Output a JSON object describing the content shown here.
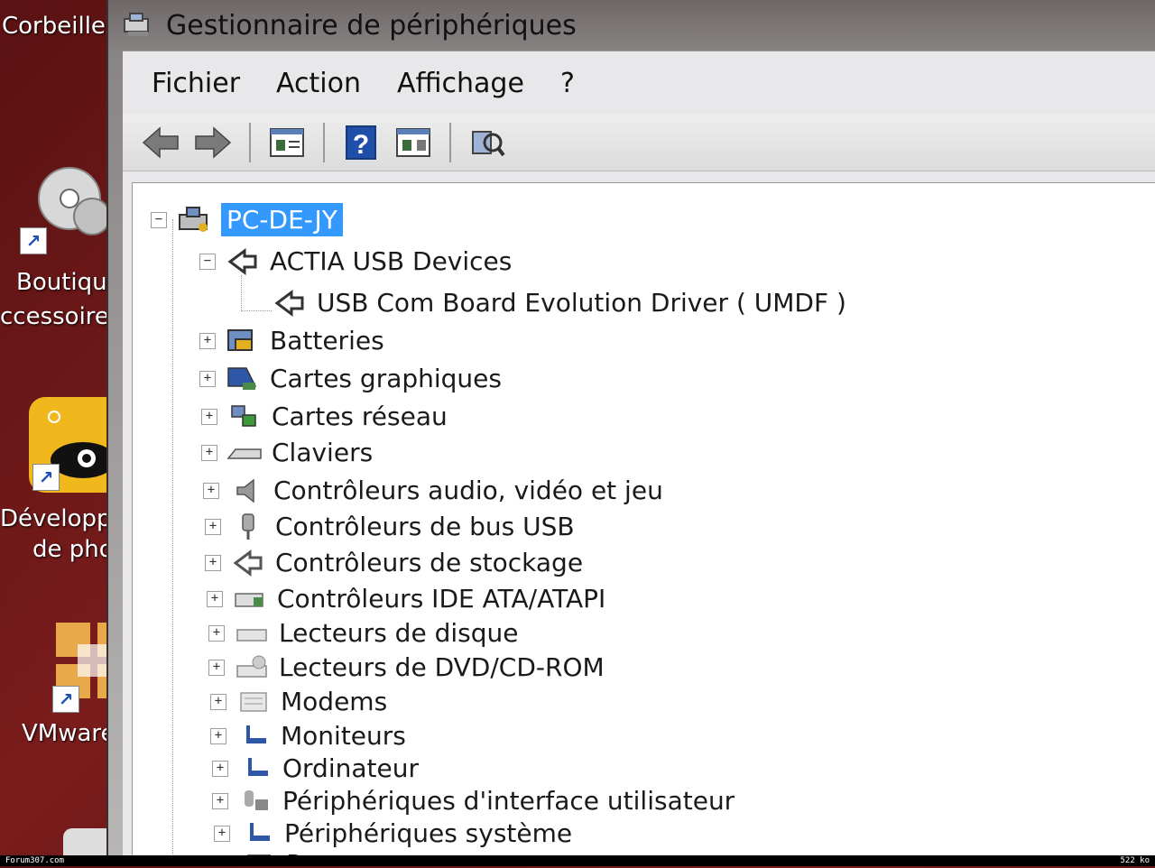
{
  "desktop": {
    "items": [
      {
        "label": "Corbeille",
        "icon": "recycle-bin-icon"
      },
      {
        "label": "Boutique",
        "label2": "ccessoires",
        "icon": "disc-icon"
      },
      {
        "label": "Développem",
        "label2": "de photo",
        "icon": "photo-app-icon"
      },
      {
        "label": "VMware Pla",
        "icon": "vmware-icon"
      }
    ]
  },
  "window": {
    "title": "Gestionnaire de périphériques",
    "icon": "device-manager-icon"
  },
  "menu": [
    "Fichier",
    "Action",
    "Affichage",
    "?"
  ],
  "toolbar": {
    "buttons": [
      "back-arrow-icon",
      "forward-arrow-icon",
      "properties-view-icon",
      "help-icon",
      "show-hide-icon",
      "scan-hardware-icon"
    ]
  },
  "tree": {
    "root": "PC-DE-JY",
    "actia": "ACTIA USB Devices",
    "actia_child": "USB Com Board Evolution Driver ( UMDF )",
    "categories": [
      "Batteries",
      "Cartes graphiques",
      "Cartes réseau",
      "Claviers",
      "Contrôleurs audio, vidéo et jeu",
      "Contrôleurs de bus USB",
      "Contrôleurs de stockage",
      "Contrôleurs IDE ATA/ATAPI",
      "Lecteurs de disque",
      "Lecteurs de DVD/CD-ROM",
      "Modems",
      "Moniteurs",
      "Ordinateur",
      "Périphériques d'interface utilisateur",
      "Périphériques système",
      "Processeurs"
    ],
    "expand_symbol": "+",
    "collapse_symbol": "−"
  },
  "footer": {
    "left": "Forum307.com",
    "right": "522 ko"
  },
  "colors": {
    "selection": "#3399ff",
    "desktop_bg": "#6a1515"
  }
}
